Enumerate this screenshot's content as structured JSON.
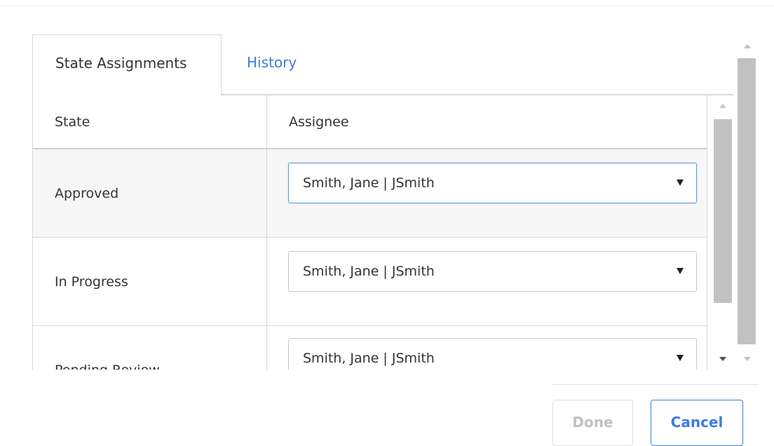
{
  "tabs": [
    {
      "label": "State Assignments",
      "active": true
    },
    {
      "label": "History",
      "active": false
    }
  ],
  "table": {
    "headers": {
      "state": "State",
      "assignee": "Assignee"
    },
    "rows": [
      {
        "state": "Approved",
        "assignee": "Smith, Jane | JSmith",
        "focused": true
      },
      {
        "state": "In Progress",
        "assignee": "Smith, Jane | JSmith",
        "focused": false
      },
      {
        "state": "Pending Review",
        "assignee": "Smith, Jane | JSmith",
        "focused": false
      }
    ]
  },
  "footer": {
    "done_label": "Done",
    "cancel_label": "Cancel",
    "done_enabled": false
  },
  "colors": {
    "accent": "#3d7ddb",
    "focus_border": "#5a97e6",
    "disabled_text": "#c0c0c0",
    "border": "#d8d8d8",
    "selected_row_bg": "#f7f7f7"
  }
}
